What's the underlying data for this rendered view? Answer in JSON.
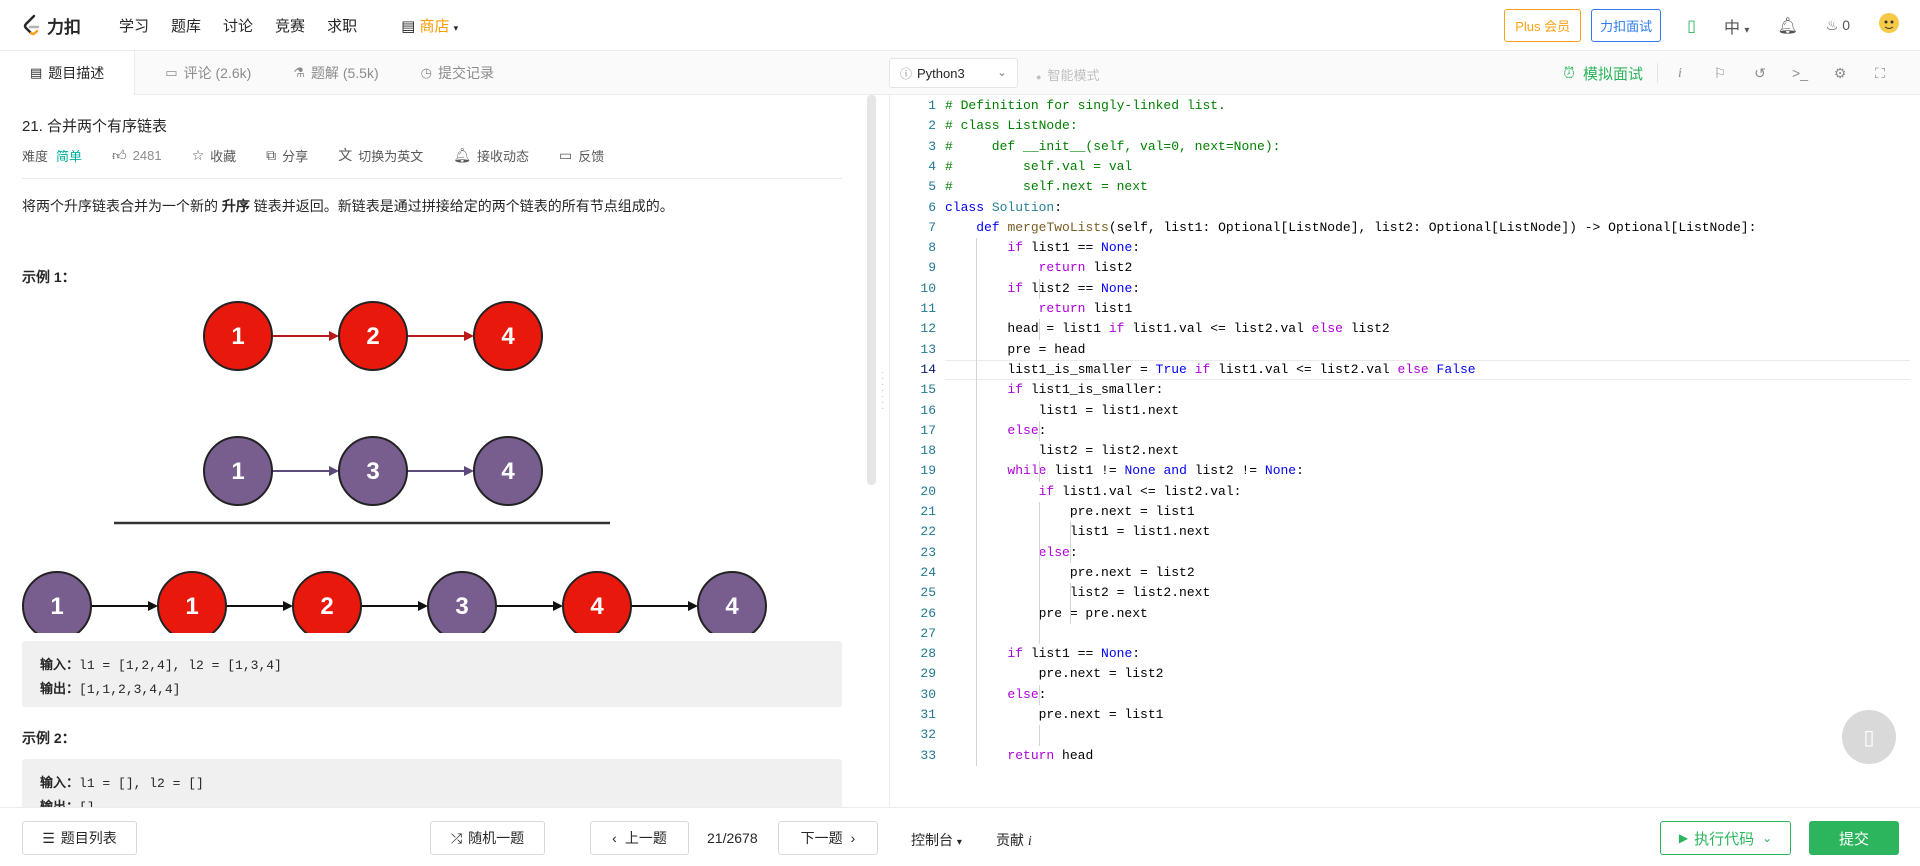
{
  "topbar": {
    "logo_text": "力扣",
    "nav": [
      "学习",
      "题库",
      "讨论",
      "竞赛",
      "求职"
    ],
    "store": "商店",
    "plus": "Plus 会员",
    "interview": "力扣面试",
    "lang": "中",
    "streak": "0"
  },
  "tabs": [
    {
      "label": "题目描述",
      "icon": "description-icon"
    },
    {
      "label": "评论 (2.6k)",
      "icon": "comment-icon"
    },
    {
      "label": "题解 (5.5k)",
      "icon": "flask-icon"
    },
    {
      "label": "提交记录",
      "icon": "history-icon"
    }
  ],
  "editor": {
    "language": "Python3",
    "smart_mode": "智能模式",
    "mock_interview": "模拟面试",
    "tool_icons": [
      "info-icon",
      "flag-icon",
      "reset-icon",
      "terminal-icon",
      "settings-icon",
      "fullscreen-icon"
    ]
  },
  "problem": {
    "title": "21. 合并两个有序链表",
    "difficulty_label": "难度",
    "difficulty": "简单",
    "likes": "2481",
    "favorite": "收藏",
    "share": "分享",
    "translate": "切换为英文",
    "subscribe": "接收动态",
    "feedback": "反馈",
    "desc_before": "将两个升序链表合并为一个新的 ",
    "desc_bold": "升序",
    "desc_after": " 链表并返回。新链表是通过拼接给定的两个链表的所有节点组成的。",
    "ex1_title": "示例 1：",
    "ex1_input_label": "输入：",
    "ex1_input": "l1 = [1,2,4], l2 = [1,3,4]",
    "ex1_output_label": "输出：",
    "ex1_output": "[1,1,2,3,4,4]",
    "ex2_title": "示例 2：",
    "ex2_input_label": "输入：",
    "ex2_input": "l1 = [], l2 = []",
    "ex2_output_label": "输出：",
    "ex2_output": "[]"
  },
  "diagram": {
    "list1": [
      "1",
      "2",
      "4"
    ],
    "list2": [
      "1",
      "3",
      "4"
    ],
    "merged": [
      {
        "v": "1",
        "color": "purple"
      },
      {
        "v": "1",
        "color": "red"
      },
      {
        "v": "2",
        "color": "red"
      },
      {
        "v": "3",
        "color": "purple"
      },
      {
        "v": "4",
        "color": "red"
      },
      {
        "v": "4",
        "color": "purple"
      }
    ],
    "colors": {
      "red": "#e8190c",
      "purple": "#775e8e"
    }
  },
  "code": [
    {
      "n": "1",
      "t": [
        [
          "cm",
          "# Definition for singly-linked list."
        ]
      ]
    },
    {
      "n": "2",
      "t": [
        [
          "cm",
          "# class ListNode:"
        ]
      ]
    },
    {
      "n": "3",
      "t": [
        [
          "cm",
          "#     def __init__(self, val=0, next=None):"
        ]
      ]
    },
    {
      "n": "4",
      "t": [
        [
          "cm",
          "#         self.val = val"
        ]
      ]
    },
    {
      "n": "5",
      "t": [
        [
          "cm",
          "#         self.next = next"
        ]
      ]
    },
    {
      "n": "6",
      "t": [
        [
          "kw",
          "class"
        ],
        [
          "",
          " "
        ],
        [
          "cls",
          "Solution"
        ],
        [
          "",
          ":"
        ]
      ]
    },
    {
      "n": "7",
      "t": [
        [
          "",
          "    "
        ],
        [
          "kw",
          "def"
        ],
        [
          "",
          " "
        ],
        [
          "fn",
          "mergeTwoLists"
        ],
        [
          "",
          "(self, list1: Optional[ListNode], list2: Optional[ListNode]) -> Optional[ListNode]:"
        ]
      ]
    },
    {
      "n": "8",
      "t": [
        [
          "",
          "        "
        ],
        [
          "kw2",
          "if"
        ],
        [
          "",
          " list1 == "
        ],
        [
          "kw",
          "None"
        ],
        [
          "",
          ":"
        ]
      ]
    },
    {
      "n": "9",
      "t": [
        [
          "",
          "            "
        ],
        [
          "kw2",
          "return"
        ],
        [
          "",
          " list2"
        ]
      ]
    },
    {
      "n": "10",
      "t": [
        [
          "",
          "        "
        ],
        [
          "kw2",
          "if"
        ],
        [
          "",
          " list2 == "
        ],
        [
          "kw",
          "None"
        ],
        [
          "",
          ":"
        ]
      ]
    },
    {
      "n": "11",
      "t": [
        [
          "",
          "            "
        ],
        [
          "kw2",
          "return"
        ],
        [
          "",
          " list1"
        ]
      ]
    },
    {
      "n": "12",
      "t": [
        [
          "",
          "        head = list1 "
        ],
        [
          "kw2",
          "if"
        ],
        [
          "",
          " list1.val <= list2.val "
        ],
        [
          "kw2",
          "else"
        ],
        [
          "",
          " list2"
        ]
      ]
    },
    {
      "n": "13",
      "t": [
        [
          "",
          "        pre = head"
        ]
      ]
    },
    {
      "n": "14",
      "t": [
        [
          "",
          "        list1_is_smaller = "
        ],
        [
          "kw",
          "True"
        ],
        [
          "",
          " "
        ],
        [
          "kw2",
          "if"
        ],
        [
          "",
          " list1.val <= list2.val "
        ],
        [
          "kw2",
          "else"
        ],
        [
          "",
          " "
        ],
        [
          "kw",
          "False"
        ]
      ]
    },
    {
      "n": "15",
      "t": [
        [
          "",
          "        "
        ],
        [
          "kw2",
          "if"
        ],
        [
          "",
          " list1_is_smaller:"
        ]
      ]
    },
    {
      "n": "16",
      "t": [
        [
          "",
          "            list1 = list1.next"
        ]
      ]
    },
    {
      "n": "17",
      "t": [
        [
          "",
          "        "
        ],
        [
          "kw2",
          "else"
        ],
        [
          "",
          ":"
        ]
      ]
    },
    {
      "n": "18",
      "t": [
        [
          "",
          "            list2 = list2.next"
        ]
      ]
    },
    {
      "n": "19",
      "t": [
        [
          "",
          "        "
        ],
        [
          "kw2",
          "while"
        ],
        [
          "",
          " list1 != "
        ],
        [
          "kw",
          "None"
        ],
        [
          "",
          " "
        ],
        [
          "kw",
          "and"
        ],
        [
          "",
          " list2 != "
        ],
        [
          "kw",
          "None"
        ],
        [
          "",
          ":"
        ]
      ]
    },
    {
      "n": "20",
      "t": [
        [
          "",
          "            "
        ],
        [
          "kw2",
          "if"
        ],
        [
          "",
          " list1.val <= list2.val:"
        ]
      ]
    },
    {
      "n": "21",
      "t": [
        [
          "",
          "                pre.next = list1"
        ]
      ]
    },
    {
      "n": "22",
      "t": [
        [
          "",
          "                list1 = list1.next"
        ]
      ]
    },
    {
      "n": "23",
      "t": [
        [
          "",
          "            "
        ],
        [
          "kw2",
          "else"
        ],
        [
          "",
          ":"
        ]
      ]
    },
    {
      "n": "24",
      "t": [
        [
          "",
          "                pre.next = list2"
        ]
      ]
    },
    {
      "n": "25",
      "t": [
        [
          "",
          "                list2 = list2.next"
        ]
      ]
    },
    {
      "n": "26",
      "t": [
        [
          "",
          "            pre = pre.next"
        ]
      ]
    },
    {
      "n": "27",
      "t": []
    },
    {
      "n": "28",
      "t": [
        [
          "",
          "        "
        ],
        [
          "kw2",
          "if"
        ],
        [
          "",
          " list1 == "
        ],
        [
          "kw",
          "None"
        ],
        [
          "",
          ":"
        ]
      ]
    },
    {
      "n": "29",
      "t": [
        [
          "",
          "            pre.next = list2"
        ]
      ]
    },
    {
      "n": "30",
      "t": [
        [
          "",
          "        "
        ],
        [
          "kw2",
          "else"
        ],
        [
          "",
          ":"
        ]
      ]
    },
    {
      "n": "31",
      "t": [
        [
          "",
          "            pre.next = list1"
        ]
      ]
    },
    {
      "n": "32",
      "t": []
    },
    {
      "n": "33",
      "t": [
        [
          "",
          "        "
        ],
        [
          "kw2",
          "return"
        ],
        [
          "",
          " head"
        ]
      ]
    }
  ],
  "bottom": {
    "problem_list": "题目列表",
    "random": "随机一题",
    "prev": "上一题",
    "progress": "21/2678",
    "next": "下一题",
    "console": "控制台",
    "contribute": "贡献",
    "run": "执行代码",
    "submit": "提交"
  }
}
